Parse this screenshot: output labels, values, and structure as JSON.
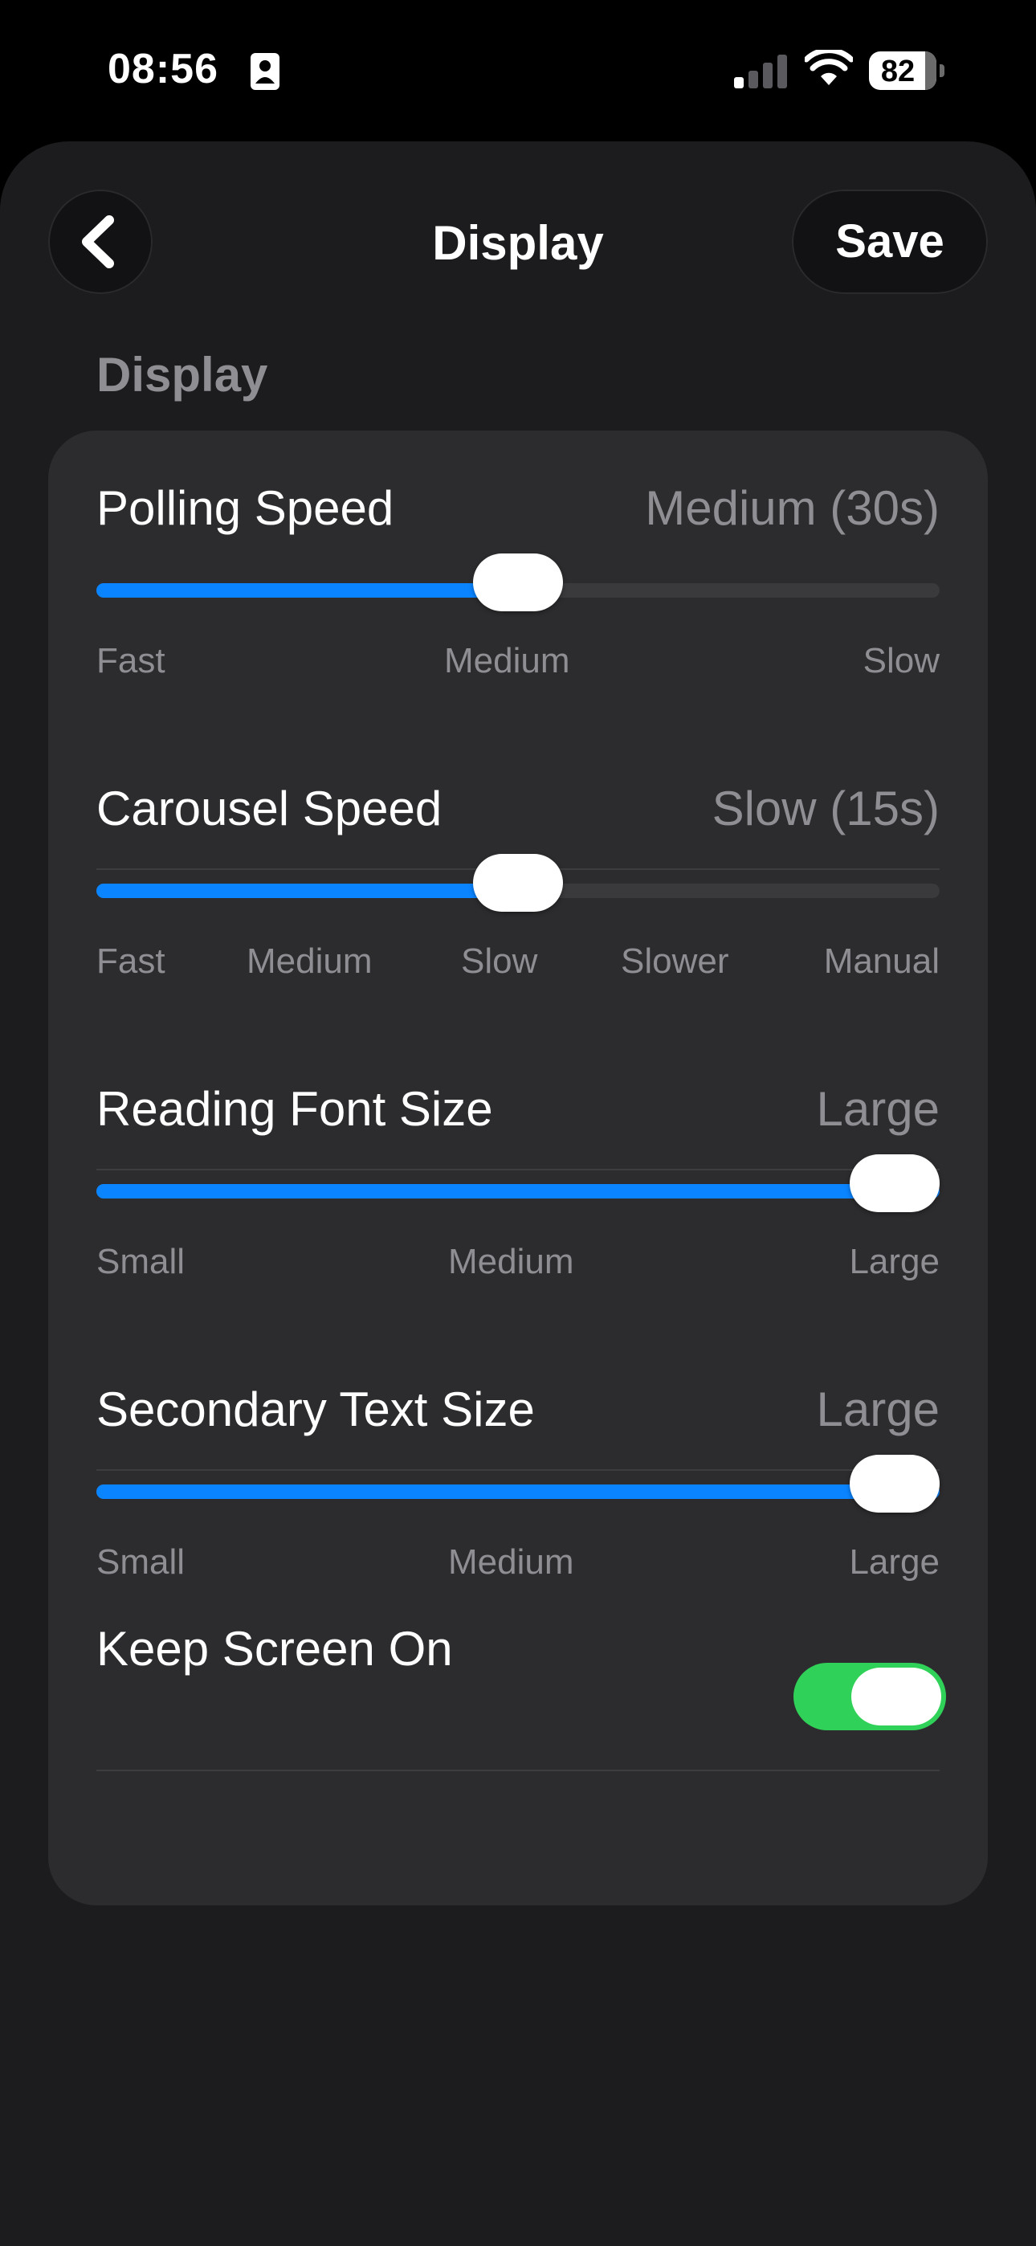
{
  "status_bar": {
    "time": "08:56",
    "battery": "82",
    "icons": [
      "focus-contact-icon",
      "cellular-signal-icon",
      "wifi-icon",
      "battery-icon"
    ]
  },
  "header": {
    "title": "Display",
    "back_icon": "chevron-left-icon",
    "save_label": "Save"
  },
  "section": {
    "title": "Display"
  },
  "settings": {
    "polling_speed": {
      "label": "Polling Speed",
      "value": "Medium (30s)",
      "ticks": [
        "Fast",
        "Medium",
        "Slow"
      ],
      "level": 0.5
    },
    "carousel_speed": {
      "label": "Carousel Speed",
      "value": "Slow (15s)",
      "ticks": [
        "Fast",
        "Medium",
        "Slow",
        "Slower",
        "Manual"
      ],
      "level": 0.5
    },
    "reading_font_size": {
      "label": "Reading Font Size",
      "value": "Large",
      "ticks": [
        "Small",
        "Medium",
        "Large"
      ],
      "level": 1.0
    },
    "secondary_text_size": {
      "label": "Secondary Text Size",
      "value": "Large",
      "ticks": [
        "Small",
        "Medium",
        "Large"
      ],
      "level": 1.0
    },
    "keep_screen_on": {
      "label": "Keep Screen On",
      "enabled": true
    }
  },
  "colors": {
    "accent": "#0a84ff",
    "toggle_on": "#30d158",
    "background": "#1c1c1e",
    "card": "#2c2c2e",
    "secondary_text": "#8e8e93"
  }
}
